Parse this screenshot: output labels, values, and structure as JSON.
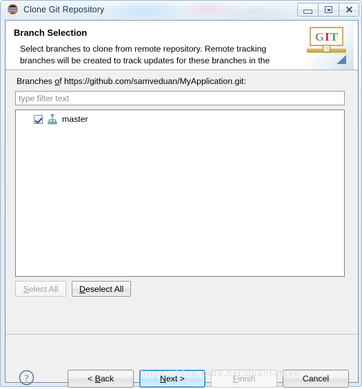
{
  "window": {
    "title": "Clone Git Repository",
    "app_icon": "eclipse-icon",
    "controls": {
      "minimize": "minimize-icon",
      "restore": "restore-icon",
      "close": "close-icon"
    }
  },
  "header": {
    "title": "Branch Selection",
    "description": "Select branches to clone from remote repository. Remote tracking branches will be created to track updates for these branches in the",
    "logo": {
      "letters": [
        "G",
        "I",
        "T"
      ],
      "colors": {
        "g": "#8e8e8e",
        "i": "#d42222",
        "t": "#3fa35c"
      }
    }
  },
  "content": {
    "branches_label_prefix": "Branches ",
    "branches_label_mnemonic": "o",
    "branches_label_suffix": "f https://github.com/samveduan/MyApplication.git:",
    "filter": {
      "value": "",
      "placeholder": "type filter text"
    },
    "tree": {
      "items": [
        {
          "label": "master",
          "checked": true,
          "icon": "git-branch-icon"
        }
      ]
    },
    "select_all": {
      "mnemonic": "S",
      "rest": "elect All",
      "enabled": false
    },
    "deselect_all": {
      "mnemonic": "D",
      "rest": "eselect All",
      "enabled": true
    }
  },
  "footer": {
    "help": "help-icon",
    "buttons": {
      "back": {
        "prefix": "< ",
        "mnemonic": "B",
        "rest": "ack",
        "enabled": true,
        "default": false
      },
      "next": {
        "prefix": "",
        "mnemonic": "N",
        "rest": "ext >",
        "enabled": true,
        "default": true
      },
      "finish": {
        "prefix": "",
        "mnemonic": "F",
        "rest": "inish",
        "enabled": false,
        "default": false
      },
      "cancel": {
        "prefix": "",
        "mnemonic": "",
        "rest": "Cancel",
        "enabled": true,
        "default": false
      }
    }
  },
  "watermark": "https://blog.csdn.net/duansamve"
}
